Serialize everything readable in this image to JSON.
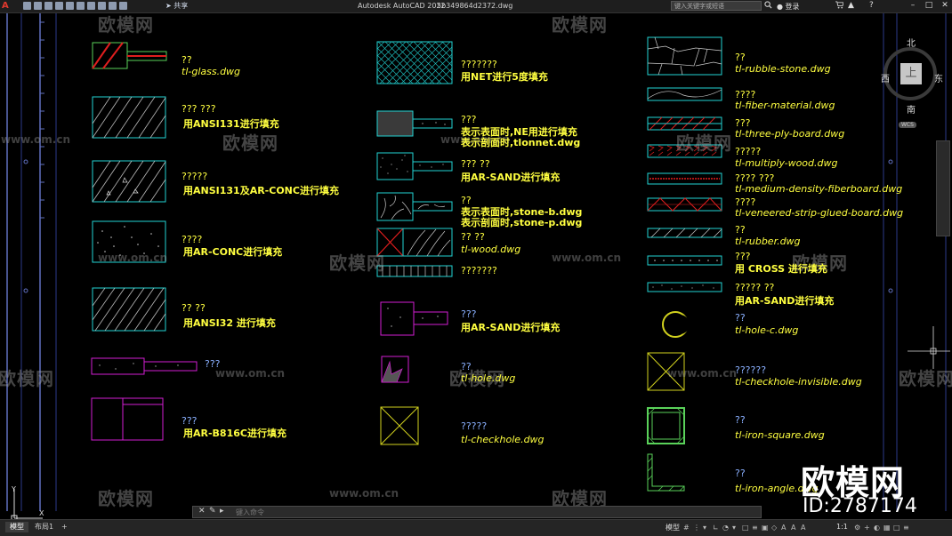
{
  "titlebar": {
    "app_title": "Autodesk AutoCAD 2022",
    "file_name": "5b349864d2372.dwg",
    "share_label": "共享",
    "search_placeholder": "键入关键字或短语",
    "login_label": "登录"
  },
  "watermark": {
    "brand": "欧模网",
    "url": "www.om.cn",
    "id_text": "ID:2787174"
  },
  "compass": {
    "north": "北",
    "south": "南",
    "west": "西",
    "east": "东",
    "top": "上",
    "wcs": "WCS"
  },
  "ucs": {
    "y": "Y",
    "x": "X"
  },
  "column1": [
    {
      "line1": "??",
      "line2": "tl-glass.dwg"
    },
    {
      "line1": "???  ???",
      "line2": "用ANSI131进行填充"
    },
    {
      "line1": "?????",
      "line2": "用ANSI131及AR-CONC进行填充"
    },
    {
      "line1": "????",
      "line2": "用AR-CONC进行填充"
    },
    {
      "line1": "??  ??",
      "line2": "用ANSI32 进行填充"
    },
    {
      "line1": "???",
      "line2": ""
    },
    {
      "line1": "???",
      "line2": "用AR-B816C进行填充"
    }
  ],
  "column2": [
    {
      "line1": "???????",
      "line2": "用NET进行5度填充"
    },
    {
      "line1": "???",
      "line2": "表示表面时,NE用进行填充",
      "line3": "表示剖面时,tlonnet.dwg"
    },
    {
      "line1": "???  ??",
      "line2": "用AR-SAND进行填充"
    },
    {
      "line1": "??",
      "line2": "表示表面时,stone-b.dwg",
      "line3": "表示剖面时,stone-p.dwg"
    },
    {
      "line1": "??  ??",
      "line2": "tl-wood.dwg"
    },
    {
      "line1": "???????",
      "line2": ""
    },
    {
      "line1": "???",
      "line2": "用AR-SAND进行填充"
    },
    {
      "line1": "??",
      "line2": "tl-hole.dwg"
    },
    {
      "line1": "?????",
      "line2": "tl-checkhole.dwg"
    }
  ],
  "column3": [
    {
      "line1": "??",
      "line2": "tl-rubble-stone.dwg"
    },
    {
      "line1": "????",
      "line2": "tl-fiber-material.dwg"
    },
    {
      "line1": "???",
      "line2": "tl-three-ply-board.dwg"
    },
    {
      "line1": "?????",
      "line2": "tl-multiply-wood.dwg"
    },
    {
      "line1": "????  ???",
      "line2": "tl-medium-density-fiberboard.dwg"
    },
    {
      "line1": "????",
      "line2": "tl-veneered-strip-glued-board.dwg"
    },
    {
      "line1": "??",
      "line2": "tl-rubber.dwg"
    },
    {
      "line1": "???",
      "line2": "用 CROSS 进行填充"
    },
    {
      "line1": "?????  ??",
      "line2": "用AR-SAND进行填充"
    },
    {
      "line1": "??",
      "line2": "tl-hole-c.dwg"
    },
    {
      "line1": "??????",
      "line2": "tl-checkhole-invisible.dwg"
    },
    {
      "line1": "??",
      "line2": "tl-iron-square.dwg"
    },
    {
      "line1": "??",
      "line2": "tl-iron-angle.dwg"
    }
  ],
  "cmdline": {
    "placeholder": "键入命令"
  },
  "statusbar": {
    "tab_model": "模型",
    "tab_layout": "布局1",
    "add_tab": "+",
    "model_label": "模型",
    "scale": "1:1"
  },
  "colors": {
    "cyan": "#22d3d3",
    "yellow": "#ffff40",
    "magenta": "#d21ed2",
    "red": "#e01e1e",
    "green": "#5ad25a",
    "blue": "#8ab0ff"
  }
}
